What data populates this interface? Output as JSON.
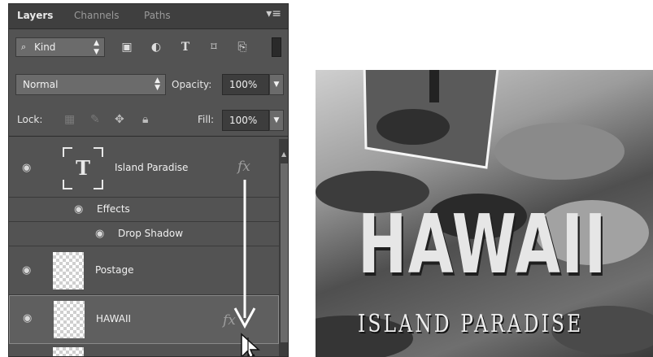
{
  "panel": {
    "tabs": [
      "Layers",
      "Channels",
      "Paths"
    ],
    "filter": {
      "kind_label": "Kind"
    },
    "blend_mode": "Normal",
    "opacity_label": "Opacity:",
    "opacity_value": "100%",
    "lock_label": "Lock:",
    "fill_label": "Fill:",
    "fill_value": "100%"
  },
  "layers": [
    {
      "name": "Island Paradise",
      "type": "text",
      "fx": "fx",
      "effects_label": "Effects",
      "effect": "Drop Shadow"
    },
    {
      "name": "Postage",
      "type": "pixel"
    },
    {
      "name": "HAWAII",
      "type": "pixel",
      "fx": "fx",
      "selected": true
    }
  ],
  "image": {
    "title": "HAWAII",
    "subtitle": "ISLAND PARADISE"
  },
  "colors": {
    "panel": "#535353",
    "selected": "#5f5f5f"
  }
}
